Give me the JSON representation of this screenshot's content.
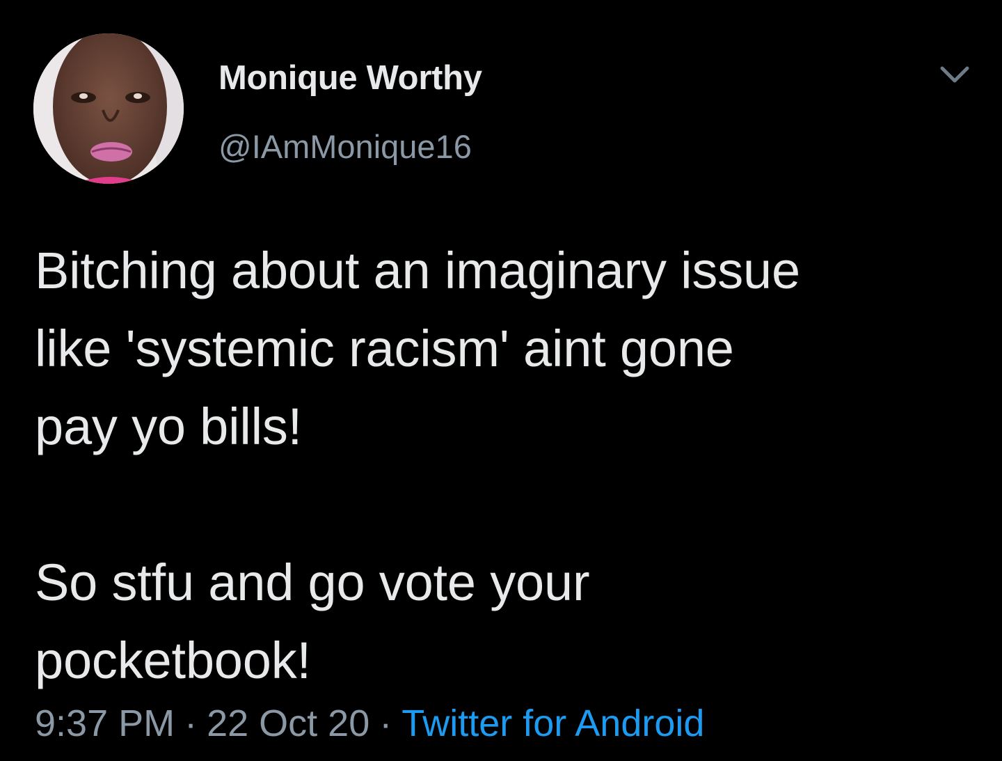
{
  "tweet": {
    "display_name": "Monique Worthy",
    "handle": "@IAmMonique16",
    "text": "Bitching about an imaginary issue\nlike 'systemic racism' aint gone\npay yo bills!\n\nSo stfu and go vote your\npocketbook!",
    "time": "9:37 PM",
    "date": "22 Oct 20",
    "separator": "·",
    "source": "Twitter for Android"
  },
  "icons": {
    "avatar": "user-avatar-photo",
    "menu": "chevron-down-icon"
  },
  "colors": {
    "background": "#000000",
    "primary_text": "#e7e9ea",
    "secondary_text": "#8b98a5",
    "link": "#1d9bf0"
  }
}
